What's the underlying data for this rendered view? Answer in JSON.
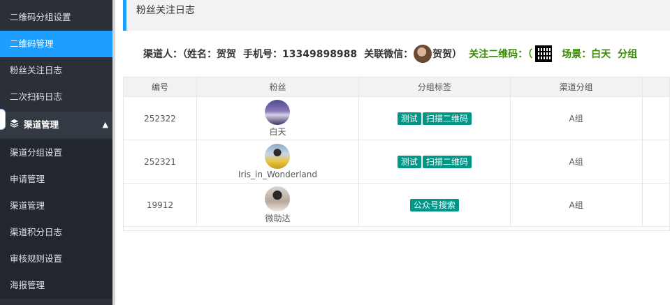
{
  "sidebar": {
    "items": [
      {
        "label": "二维码分组设置"
      },
      {
        "label": "二维码管理"
      },
      {
        "label": "粉丝关注日志"
      },
      {
        "label": "二次扫码日志"
      }
    ],
    "group": {
      "label": "渠道管理"
    },
    "sub_items": [
      {
        "label": "渠道分组设置"
      },
      {
        "label": "申请管理"
      },
      {
        "label": "渠道管理"
      },
      {
        "label": "渠道积分日志"
      },
      {
        "label": "审核规则设置"
      },
      {
        "label": "海报管理"
      }
    ]
  },
  "page": {
    "title": "粉丝关注日志"
  },
  "info": {
    "prefix": "渠道人：（",
    "name_label": "姓名：贺贺",
    "phone_label": "手机号：13349898988",
    "wechat_label": "关联微信：",
    "wechat_name": "贺贺）",
    "qr_label": "关注二维码：（",
    "scene_label": "场景：白天",
    "group_label": "分组"
  },
  "table": {
    "headers": [
      "编号",
      "粉丝",
      "分组标签",
      "渠道分组",
      ""
    ],
    "rows": [
      {
        "id": "252322",
        "fan": "白天",
        "tags": [
          "测试",
          "扫描二维码"
        ],
        "group": "A组"
      },
      {
        "id": "252321",
        "fan": "Iris_in_Wonderland",
        "tags": [
          "测试",
          "扫描二维码"
        ],
        "group": "A组"
      },
      {
        "id": "19912",
        "fan": "微助达",
        "tags": [
          "公众号搜索"
        ],
        "group": "A组"
      }
    ]
  },
  "colors": {
    "accent": "#1e9fff",
    "sidebar": "#2a2f38",
    "tag": "#009688",
    "green": "#3a8c00"
  }
}
